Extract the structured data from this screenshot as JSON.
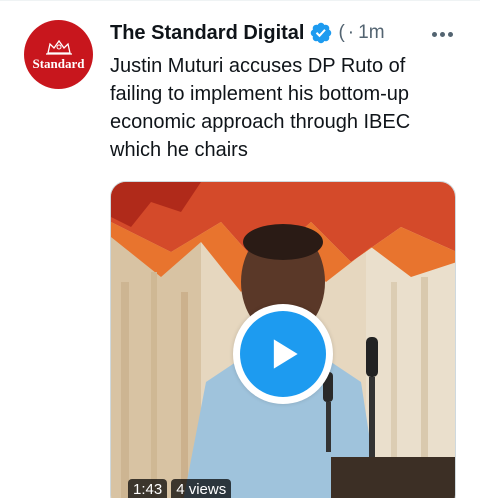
{
  "account": {
    "display_name": "The Standard Digital",
    "avatar_label": "Standard",
    "handle_fragment": "(",
    "separator": "·",
    "timestamp": "1m"
  },
  "tweet": {
    "text": "Justin Muturi accuses DP Ruto of failing to implement his bottom-up economic approach through IBEC which he chairs"
  },
  "video": {
    "duration": "1:43",
    "views": "4 views"
  },
  "icons": {
    "verified": "verified-badge-icon",
    "more": "more-icon",
    "play": "play-icon"
  },
  "colors": {
    "accent": "#1d9bf0",
    "avatar_bg": "#c8161d",
    "text": "#0f1419",
    "secondary_text": "#536471"
  }
}
